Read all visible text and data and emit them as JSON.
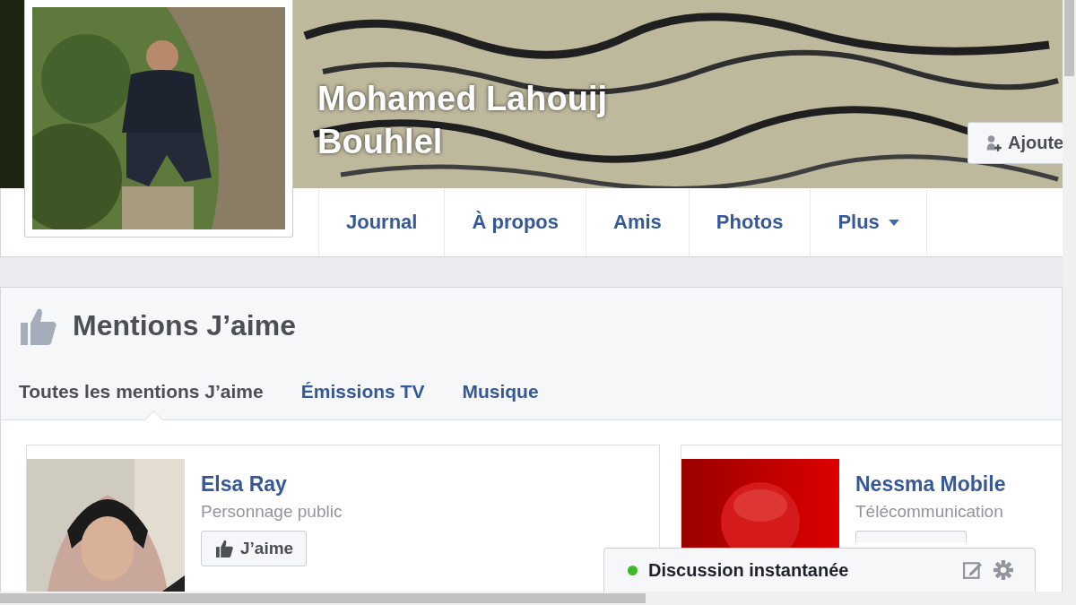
{
  "profile": {
    "name": "Mohamed Lahouij Bouhlel",
    "add_friend": "Ajoute"
  },
  "nav": [
    {
      "label": "Journal",
      "kind": "link"
    },
    {
      "label": "À propos",
      "kind": "link"
    },
    {
      "label": "Amis",
      "kind": "link"
    },
    {
      "label": "Photos",
      "kind": "link"
    },
    {
      "label": "Plus",
      "kind": "menu"
    }
  ],
  "likes": {
    "title": "Mentions J’aime",
    "tabs": [
      {
        "label": "Toutes les mentions J’aime",
        "selected": true
      },
      {
        "label": "Émissions TV",
        "selected": false
      },
      {
        "label": "Musique",
        "selected": false
      }
    ],
    "pages": [
      {
        "name": "Elsa Ray",
        "category": "Personnage public",
        "button": "J’aime",
        "kind": "person"
      },
      {
        "name": "Nessma Mobile",
        "category": "Télécommunication",
        "kind": "brand"
      }
    ]
  },
  "chat": {
    "title": "Discussion instantanée",
    "online": true
  }
}
